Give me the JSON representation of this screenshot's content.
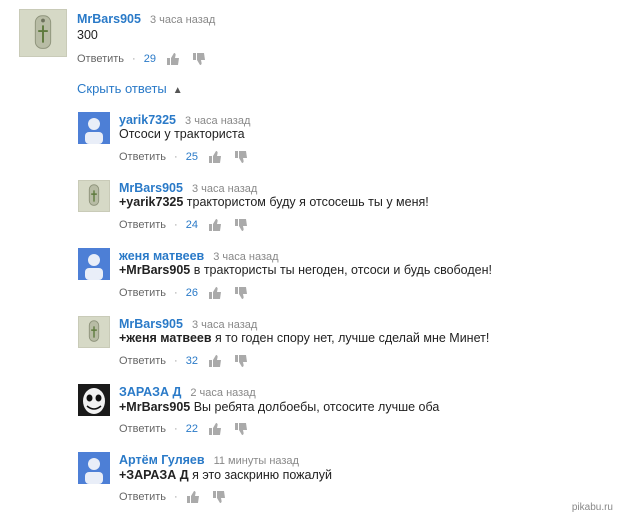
{
  "colors": {
    "author": "#2a7ac8",
    "count": "#2a7ac8",
    "text": "#222222",
    "meta": "#888888"
  },
  "top_comment": {
    "author": "MrBars905",
    "time": "3 часа назад",
    "text": "300",
    "reply_label": "Ответить",
    "separator": "·",
    "likes": "29"
  },
  "hide_replies_label": "Скрыть ответы",
  "replies": [
    {
      "author": "yarik7325",
      "time": "3 часа назад",
      "mention": "",
      "text": "Отсоси у тракториста",
      "reply_label": "Ответить",
      "separator": "·",
      "likes": "25"
    },
    {
      "author": "MrBars905",
      "time": "3 часа назад",
      "mention": "+yarik7325",
      "text": " трактористом буду я отсосешь ты у меня!",
      "reply_label": "Ответить",
      "separator": "·",
      "likes": "24"
    },
    {
      "author": "женя матвеев",
      "time": "3 часа назад",
      "mention": "+MrBars905",
      "text": " в трактористы ты негоден, отсоси и будь свободен!",
      "reply_label": "Ответить",
      "separator": "·",
      "likes": "26"
    },
    {
      "author": "MrBars905",
      "time": "3 часа назад",
      "mention": "+женя матвеев",
      "text": " я то годен спору нет, лучше сделай мне Минет!",
      "reply_label": "Ответить",
      "separator": "·",
      "likes": "32"
    },
    {
      "author": "ЗАРАЗА Д",
      "time": "2 часа назад",
      "mention": "+MrBars905",
      "text": " Вы ребята долбоебы, отсосите лучше оба",
      "reply_label": "Ответить",
      "separator": "·",
      "likes": "22"
    },
    {
      "author": "Артём Гуляев",
      "time": "11 минуты назад",
      "mention": "+ЗАРАЗА Д",
      "text": " я это заскриню пожалуй",
      "reply_label": "Ответить",
      "separator": "·",
      "likes": ""
    }
  ],
  "watermark": "pikabu.ru"
}
